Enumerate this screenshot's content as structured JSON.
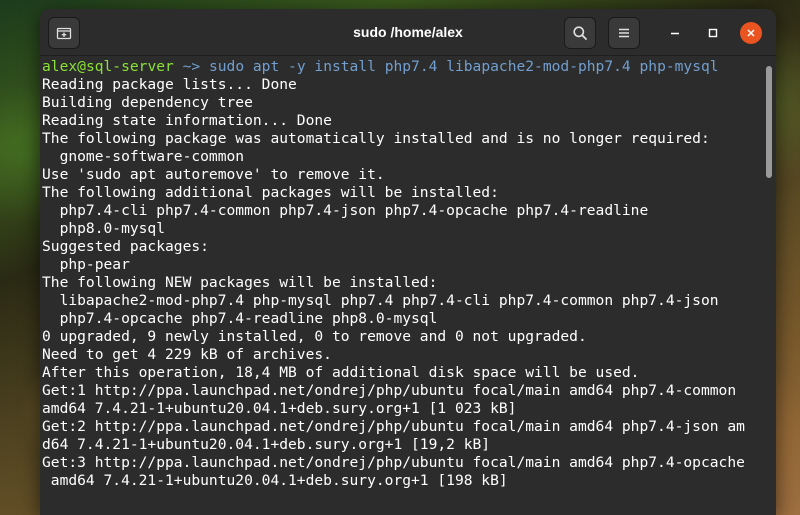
{
  "window": {
    "title": "sudo /home/alex"
  },
  "prompt": {
    "user": "alex",
    "host": "@sql-server",
    "path": " ~> ",
    "command": "sudo apt -y install php7.4 libapache2-mod-php7.4 php-mysql"
  },
  "output": [
    "Reading package lists... Done",
    "Building dependency tree",
    "Reading state information... Done",
    "The following package was automatically installed and is no longer required:",
    "  gnome-software-common",
    "Use 'sudo apt autoremove' to remove it.",
    "The following additional packages will be installed:",
    "  php7.4-cli php7.4-common php7.4-json php7.4-opcache php7.4-readline",
    "  php8.0-mysql",
    "Suggested packages:",
    "  php-pear",
    "The following NEW packages will be installed:",
    "  libapache2-mod-php7.4 php-mysql php7.4 php7.4-cli php7.4-common php7.4-json",
    "  php7.4-opcache php7.4-readline php8.0-mysql",
    "0 upgraded, 9 newly installed, 0 to remove and 0 not upgraded.",
    "Need to get 4 229 kB of archives.",
    "After this operation, 18,4 MB of additional disk space will be used.",
    "Get:1 http://ppa.launchpad.net/ondrej/php/ubuntu focal/main amd64 php7.4-common",
    "amd64 7.4.21-1+ubuntu20.04.1+deb.sury.org+1 [1 023 kB]",
    "Get:2 http://ppa.launchpad.net/ondrej/php/ubuntu focal/main amd64 php7.4-json am",
    "d64 7.4.21-1+ubuntu20.04.1+deb.sury.org+1 [19,2 kB]",
    "Get:3 http://ppa.launchpad.net/ondrej/php/ubuntu focal/main amd64 php7.4-opcache",
    " amd64 7.4.21-1+ubuntu20.04.1+deb.sury.org+1 [198 kB]"
  ],
  "icons": {
    "new_tab": "new-tab-icon",
    "search": "search-icon",
    "menu": "hamburger-menu-icon",
    "minimize": "minimize-icon",
    "maximize": "maximize-icon",
    "close": "close-icon"
  },
  "colors": {
    "prompt_user": "#8ae234",
    "prompt_command": "#729fcf",
    "close_button": "#e95420",
    "terminal_bg": "#2c2c2c"
  }
}
